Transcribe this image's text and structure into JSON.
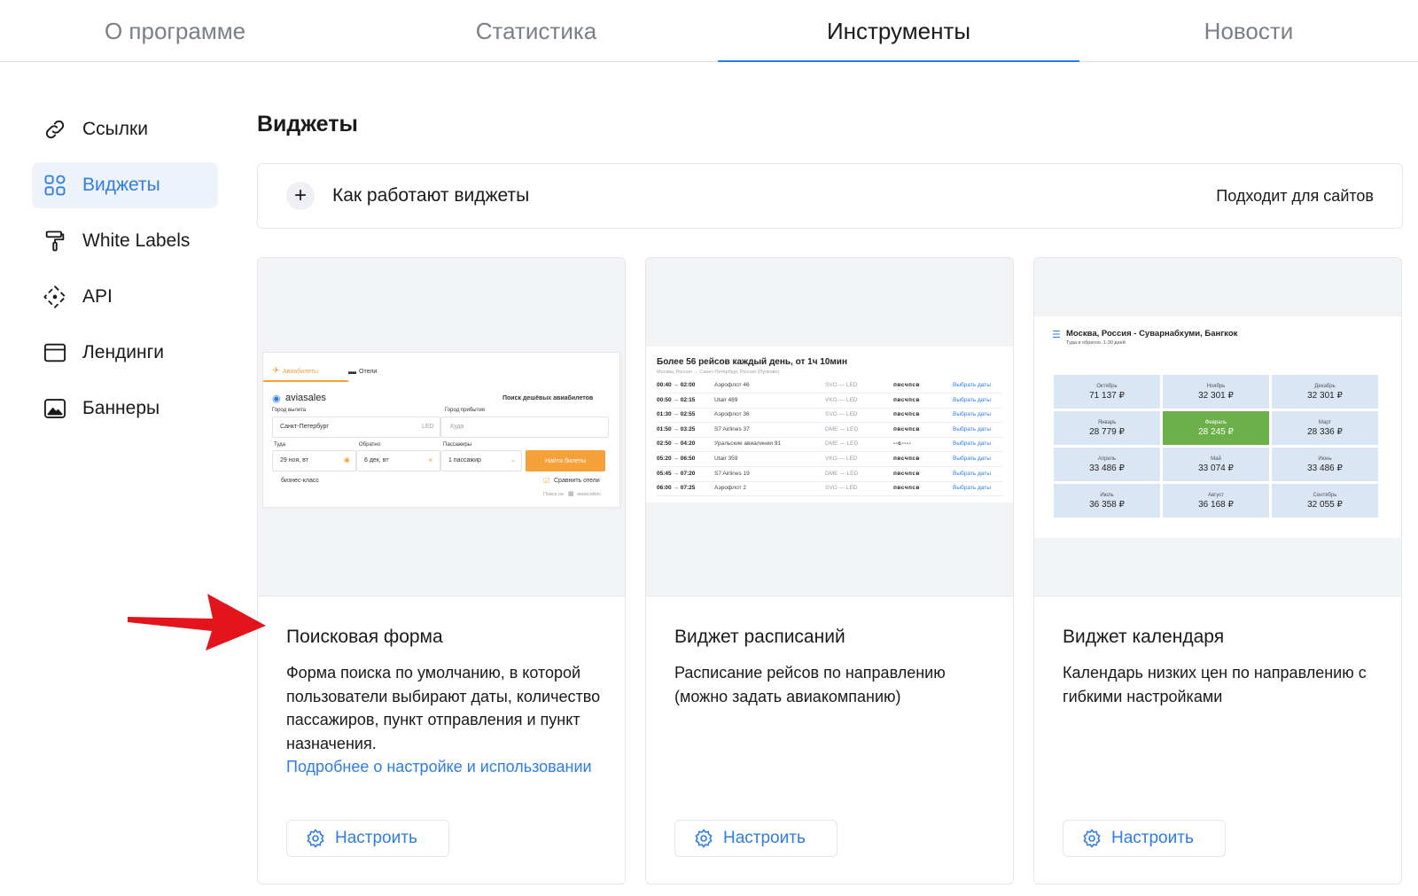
{
  "topnav": {
    "tabs": [
      {
        "label": "О программе"
      },
      {
        "label": "Статистика"
      },
      {
        "label": "Инструменты"
      },
      {
        "label": "Новости"
      }
    ],
    "active_index": 2
  },
  "sidebar": {
    "items": [
      {
        "label": "Ссылки",
        "icon": "link-icon"
      },
      {
        "label": "Виджеты",
        "icon": "widgets-grid-icon"
      },
      {
        "label": "White Labels",
        "icon": "paint-roller-icon"
      },
      {
        "label": "API",
        "icon": "api-icon"
      },
      {
        "label": "Лендинги",
        "icon": "landing-page-icon"
      },
      {
        "label": "Баннеры",
        "icon": "image-banner-icon"
      }
    ],
    "active_index": 1
  },
  "main": {
    "title": "Виджеты",
    "how_it_works": {
      "label": "Как работают виджеты",
      "suits": "Подходит для сайтов"
    }
  },
  "cards": [
    {
      "title": "Поисковая форма",
      "desc": "Форма поиска по умолчанию, в которой пользователи выбирают даты, количество пассажиров, пункт отправления и пункт назначения.",
      "link": "Подробнее о настройке и использовании",
      "button": "Настроить"
    },
    {
      "title": "Виджет расписаний",
      "desc": "Расписание рейсов по направлению (можно задать авиакомпанию)",
      "button": "Настроить"
    },
    {
      "title": "Виджет календаря",
      "desc": "Календарь низких цен по направлению с гибкими настройками",
      "button": "Настроить"
    }
  ],
  "search_preview": {
    "tab_flights": "Авиабилеты",
    "tab_hotels": "Отели",
    "brand": "aviasales",
    "heading": "Поиск дешёвых авиабилетов",
    "from_label": "Город вылета",
    "from_value": "Санкт-Петербург",
    "from_code": "LED",
    "to_label": "Город прибытия",
    "to_placeholder": "Куда",
    "depart_label": "Туда",
    "depart_value": "29 ноя, вт",
    "return_label": "Обратно",
    "return_value": "6 дек, вт",
    "pax_label": "Пассажиры",
    "pax_value": "1 пассажир",
    "search_button": "Найти билеты",
    "business": "бизнес-класс",
    "compare_hotels": "Сравнить отели",
    "footer": "Поиск на",
    "footer_brand": "авиасейлс"
  },
  "schedule_preview": {
    "heading": "Более 56 рейсов каждый день, от 1ч 10мин",
    "subheading": "Москва, Россия → Санкт-Петербург, Россия (Пулково)",
    "action": "Выбрать даты",
    "rows": [
      {
        "time": "00:40 → 02:00",
        "airline": "Аэрофлот 46",
        "route": "SVO — LED",
        "days": "пвсчпсв"
      },
      {
        "time": "00:50 → 02:15",
        "airline": "Utair 489",
        "route": "VKO — LED",
        "days": "пвсчпсв"
      },
      {
        "time": "01:30 → 02:55",
        "airline": "Аэрофлот 36",
        "route": "SVO — LED",
        "days": "пвсчпсв"
      },
      {
        "time": "01:50 → 03:25",
        "airline": "S7 Airlines 37",
        "route": "DME — LED",
        "days": "пвсчпсв"
      },
      {
        "time": "02:50 → 04:20",
        "airline": "Уральские авиалинии 91",
        "route": "DME — LED",
        "days": "--с----"
      },
      {
        "time": "05:20 → 06:50",
        "airline": "Utair 359",
        "route": "VKO — LED",
        "days": "пвсчпсв"
      },
      {
        "time": "05:45 → 07:20",
        "airline": "S7 Airlines 19",
        "route": "DME — LED",
        "days": "пвсчпсв"
      },
      {
        "time": "06:00 → 07:25",
        "airline": "Аэрофлот 2",
        "route": "SVO — LED",
        "days": "пвсчпсв"
      }
    ]
  },
  "calendar_preview": {
    "heading": "Москва, Россия - Суварнабхуми, Бангкок",
    "subheading": "Туда и обратно, 1-30 дней",
    "cells": [
      {
        "month": "Октябрь",
        "price": "71 137 ₽"
      },
      {
        "month": "Ноябрь",
        "price": "32 301 ₽"
      },
      {
        "month": "Декабрь",
        "price": "32 301 ₽"
      },
      {
        "month": "Январь",
        "price": "28 779 ₽"
      },
      {
        "month": "Февраль",
        "price": "28 245 ₽"
      },
      {
        "month": "Март",
        "price": "28 336 ₽"
      },
      {
        "month": "Апрель",
        "price": "33 486 ₽"
      },
      {
        "month": "Май",
        "price": "33 074 ₽"
      },
      {
        "month": "Июнь",
        "price": "33 486 ₽"
      },
      {
        "month": "Июль",
        "price": "36 358 ₽"
      },
      {
        "month": "Август",
        "price": "36 168 ₽"
      },
      {
        "month": "Сентябрь",
        "price": "32 055 ₽"
      }
    ],
    "highlight_index": 4
  },
  "colors": {
    "accent": "#2e7ce6",
    "search_button": "#f6a03a",
    "calendar_highlight": "#6cb04a",
    "arrow": "#e3141b"
  }
}
